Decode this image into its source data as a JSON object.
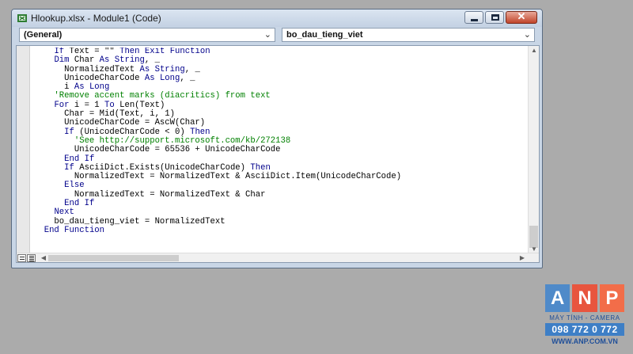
{
  "window": {
    "title": "Hlookup.xlsx - Module1 (Code)",
    "min_label": "",
    "close_label": "✕"
  },
  "combos": {
    "object": "(General)",
    "procedure": "bo_dau_tieng_viet",
    "arrow": "⌄"
  },
  "code_lines": [
    {
      "text": "    If Text = \"\" Then Exit Function",
      "kind": "normal"
    },
    {
      "text": "    Dim Char As String, _",
      "kind": "normal"
    },
    {
      "text": "      NormalizedText As String, _",
      "kind": "normal"
    },
    {
      "text": "      UnicodeCharCode As Long, _",
      "kind": "normal"
    },
    {
      "text": "      i As Long",
      "kind": "normal"
    },
    {
      "text": "    'Remove accent marks (diacritics) from text",
      "kind": "comment"
    },
    {
      "text": "    For i = 1 To Len(Text)",
      "kind": "normal"
    },
    {
      "text": "      Char = Mid(Text, i, 1)",
      "kind": "normal"
    },
    {
      "text": "      UnicodeCharCode = AscW(Char)",
      "kind": "normal"
    },
    {
      "text": "      If (UnicodeCharCode < 0) Then",
      "kind": "normal"
    },
    {
      "text": "        'See http://support.microsoft.com/kb/272138",
      "kind": "comment"
    },
    {
      "text": "        UnicodeCharCode = 65536 + UnicodeCharCode",
      "kind": "normal"
    },
    {
      "text": "      End If",
      "kind": "normal"
    },
    {
      "text": "      If AsciiDict.Exists(UnicodeCharCode) Then",
      "kind": "normal"
    },
    {
      "text": "        NormalizedText = NormalizedText & AsciiDict.Item(UnicodeCharCode)",
      "kind": "normal"
    },
    {
      "text": "      Else",
      "kind": "normal"
    },
    {
      "text": "        NormalizedText = NormalizedText & Char",
      "kind": "normal"
    },
    {
      "text": "      End If",
      "kind": "normal"
    },
    {
      "text": "    Next",
      "kind": "normal"
    },
    {
      "text": "    bo_dau_tieng_viet = NormalizedText",
      "kind": "normal"
    },
    {
      "text": "  End Function",
      "kind": "normal"
    }
  ],
  "scroll": {
    "up": "▲",
    "down": "▼",
    "left": "◀",
    "right": "▶"
  },
  "logo": {
    "letters": [
      "A",
      "N",
      "P"
    ],
    "subtitle": "MÁY TÍNH - CAMERA",
    "phone": "098 772 0 772",
    "website": "WWW.ANP.COM.VN"
  },
  "colors": {
    "keyword": "#00008b",
    "comment": "#008000",
    "logo_blue": "#4f8ac9",
    "logo_red": "#e8553e"
  }
}
